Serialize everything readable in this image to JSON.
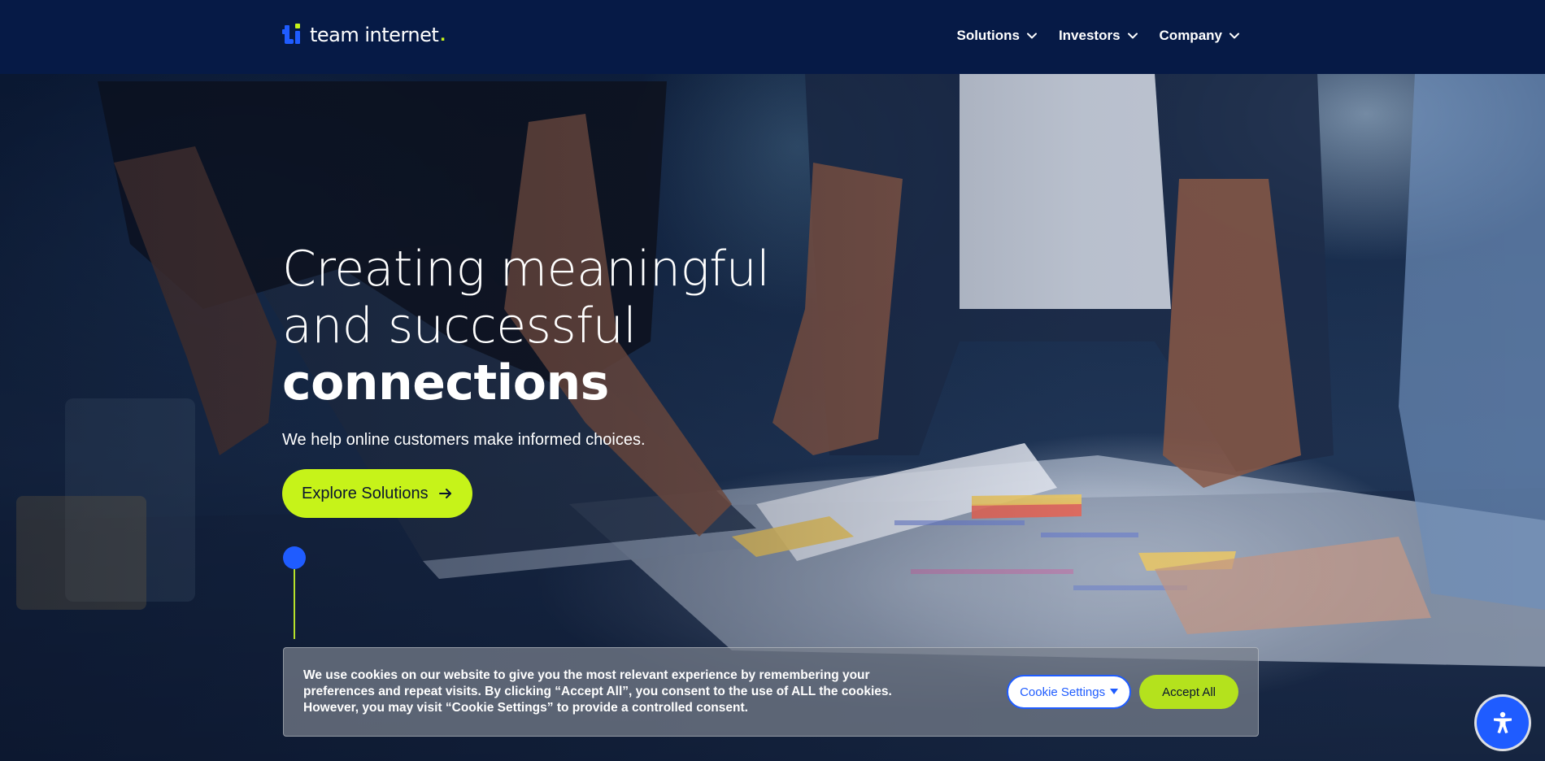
{
  "brand": {
    "name": "team internet",
    "dot": ".",
    "logo_icon": "ti-logo-icon",
    "accent_color": "#c6f319",
    "primary_color": "#1f5cff",
    "header_color": "#061a46"
  },
  "nav": {
    "items": [
      {
        "label": "Solutions",
        "icon": "chevron-down-icon"
      },
      {
        "label": "Investors",
        "icon": "chevron-down-icon"
      },
      {
        "label": "Company",
        "icon": "chevron-down-icon"
      }
    ]
  },
  "hero": {
    "title_line1": "Creating meaningful",
    "title_line2": "and successful",
    "title_line3": "connections",
    "subtitle": "We help online customers make informed choices.",
    "cta_label": "Explore Solutions",
    "cta_icon": "arrow-right-icon"
  },
  "cookie": {
    "text": "We use cookies on our website to give you the most relevant experience by remembering your preferences and repeat visits. By clicking “Accept All”, you consent to the use of ALL the cookies. However, you may visit “Cookie Settings” to provide a controlled consent.",
    "settings_label": "Cookie Settings",
    "settings_icon": "caret-down-icon",
    "accept_label": "Accept All"
  },
  "accessibility": {
    "icon": "accessibility-icon"
  }
}
